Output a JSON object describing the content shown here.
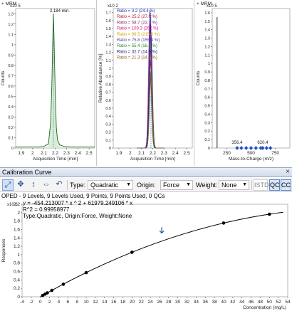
{
  "chrom": {
    "title": "+ MRM",
    "y_label": "Counts",
    "exponent": "x10 5",
    "peak_label": "2.184 min.",
    "x_ticks": [
      "1.9",
      "2",
      "2.1",
      "2.2",
      "2.3",
      "2.4",
      "2.5"
    ],
    "y_ticks": [
      "0",
      "0.1",
      "0.2",
      "0.3",
      "0.4",
      "0.5",
      "0.6",
      "0.7",
      "0.8",
      "0.9",
      "1",
      "1.1",
      "1.2",
      "1.3"
    ],
    "x_label": "Acquisition Time [min]"
  },
  "qual": {
    "y_label": "Relative Abundance [%]",
    "exponent": "x10 2",
    "x_ticks": [
      "1.9",
      "2",
      "2.1",
      "2.2",
      "2.3",
      "2.4",
      "2.5"
    ],
    "y_ticks": [
      "0",
      "0.1",
      "0.2",
      "0.3",
      "0.4",
      "0.5",
      "0.6",
      "0.7",
      "0.8",
      "0.9",
      "1",
      "1.1",
      "1.2",
      "1.3",
      "1.4",
      "1.5",
      "1.6",
      "1.7"
    ],
    "x_label": "Acquisition Time [min]",
    "ratios": [
      {
        "text": "Ratio = 3.2 (24.4 %)",
        "color": "#2233cc"
      },
      {
        "text": "Ratio = 25.2 (27.0 %)",
        "color": "#b22222"
      },
      {
        "text": "Ratio = 58.7 (22.7 %)",
        "color": "#7a2a7a"
      },
      {
        "text": "Ratio = 109.3 (262 %)",
        "color": "#e0148a"
      },
      {
        "text": "Ratio = 99.5 (215.0 %)",
        "color": "#d2a400"
      },
      {
        "text": "Ratio = 75.8 (155.4 %)",
        "color": "#5a3aa0"
      },
      {
        "text": "Ratio = 55.4 (16.4 %)",
        "color": "#2b8a2b"
      },
      {
        "text": "Ratio = 32.7 (14.9 %)",
        "color": "#1a1a8a"
      },
      {
        "text": "Ratio = 21.3 (14.3 %)",
        "color": "#8a6a1a"
      }
    ]
  },
  "spec": {
    "title": "+ MRM",
    "y_label": "Counts",
    "exponent": "x10 5",
    "x_ticks": [
      "250",
      "500",
      "750"
    ],
    "y_ticks": [
      "0",
      "0.1",
      "0.2",
      "0.3",
      "0.4",
      "0.5",
      "0.6",
      "0.7",
      "0.8",
      "0.9",
      "1",
      "1.1",
      "1.2",
      "1.3",
      "1.4",
      "1.5",
      "1.6"
    ],
    "x_label": "Mass-to-Charge (m/z)",
    "mass_labels": [
      "356.4",
      "620.4"
    ]
  },
  "calibration": {
    "panel_title": "Calibration Curve",
    "close_glyph": "×",
    "type_label": "Type:",
    "type_value": "Quadratic",
    "origin_label": "Origin:",
    "origin_value": "Force",
    "weight_label": "Weight:",
    "weight_value": "None",
    "istd_label": "ISTD",
    "qc_label": "QC",
    "cc_label": "CC",
    "summary": "OPED - 9 Levels, 9 Levels Used, 9 Points, 9 Points Used, 0 QCs",
    "equation": "y = -454.213007 * x ^ 2 + 61979.249106 * x",
    "r_squared": "R^2 = 0.99958977",
    "type_line": "Type:Quadratic, Origin:Force, Weight:None",
    "exponent": "x10 6",
    "y_label": "Responses",
    "x_label": "Concentration (mg/L)",
    "icons": [
      "zoom-fit-icon",
      "pan-icon",
      "zoom-vertical-icon",
      "zoom-horizontal-icon",
      "undo-icon"
    ],
    "colors": {
      "accent": "#1c4f9c",
      "points": "#000000",
      "curve": "#000000"
    }
  },
  "chart_data": [
    {
      "type": "line",
      "title": "+ MRM",
      "ylabel": "Counts",
      "xlabel": "Acquisition Time [min]",
      "y_exponent": "x10 5",
      "xlim": [
        1.85,
        2.55
      ],
      "ylim": [
        0,
        1.35
      ],
      "x": [
        1.85,
        1.95,
        2.05,
        2.1,
        2.14,
        2.16,
        2.17,
        2.18,
        2.184,
        2.19,
        2.2,
        2.21,
        2.22,
        2.24,
        2.28,
        2.35,
        2.45,
        2.55
      ],
      "series": [
        {
          "values": [
            0.01,
            0.01,
            0.01,
            0.015,
            0.04,
            0.25,
            0.6,
            1.1,
            1.3,
            1.05,
            0.55,
            0.2,
            0.08,
            0.03,
            0.015,
            0.01,
            0.01,
            0.01
          ]
        }
      ],
      "annotations": [
        {
          "x": 2.184,
          "text": "2.184 min."
        }
      ]
    },
    {
      "type": "line",
      "ylabel": "Relative Abundance [%]",
      "xlabel": "Acquisition Time [min]",
      "y_exponent": "x10 2",
      "xlim": [
        1.85,
        2.55
      ],
      "ylim": [
        0,
        1.75
      ],
      "legend": "top-left"
    },
    {
      "type": "bar",
      "title": "+ MRM",
      "ylabel": "Counts",
      "xlabel": "Mass-to-Charge (m/z)",
      "y_exponent": "x10 5",
      "xlim": [
        100,
        900
      ],
      "ylim": [
        0,
        1.65
      ],
      "x": [
        150,
        356.4,
        400,
        450,
        500,
        550,
        600,
        620.4,
        660,
        700
      ],
      "values": [
        1.55,
        0.01,
        0.01,
        0.01,
        0.01,
        0.01,
        0.01,
        0.01,
        0.01,
        0.01
      ],
      "annotations": [
        {
          "x": 356.4,
          "text": "356.4"
        },
        {
          "x": 620.4,
          "text": "620.4"
        }
      ]
    },
    {
      "type": "scatter",
      "title": "Calibration Curve",
      "xlabel": "Concentration (mg/L)",
      "ylabel": "Responses",
      "y_exponent": "x10 6",
      "xlim": [
        -4,
        54
      ],
      "ylim": [
        0,
        2.2
      ],
      "x_ticks": [
        -4,
        -2,
        0,
        2,
        4,
        6,
        8,
        10,
        12,
        14,
        16,
        18,
        20,
        22,
        24,
        26,
        28,
        30,
        32,
        34,
        36,
        38,
        40,
        42,
        44,
        46,
        48,
        50,
        52,
        54
      ],
      "y_ticks": [
        0,
        0.2,
        0.4,
        0.6,
        0.8,
        1,
        1.2,
        1.4,
        1.6,
        1.8,
        2,
        2.2
      ],
      "points": [
        {
          "x": 0.5,
          "y": 0.031
        },
        {
          "x": 1,
          "y": 0.062
        },
        {
          "x": 1.5,
          "y": 0.092
        },
        {
          "x": 2.5,
          "y": 0.152
        },
        {
          "x": 5,
          "y": 0.298
        },
        {
          "x": 10,
          "y": 0.574
        },
        {
          "x": 20,
          "y": 1.058
        },
        {
          "x": 40,
          "y": 1.753
        },
        {
          "x": 50,
          "y": 1.963
        }
      ],
      "curve": {
        "a": -454.213007,
        "b": 61979.249106,
        "scale": 1000000
      },
      "marker": {
        "x": 26.5,
        "y": 1.5
      }
    }
  ]
}
